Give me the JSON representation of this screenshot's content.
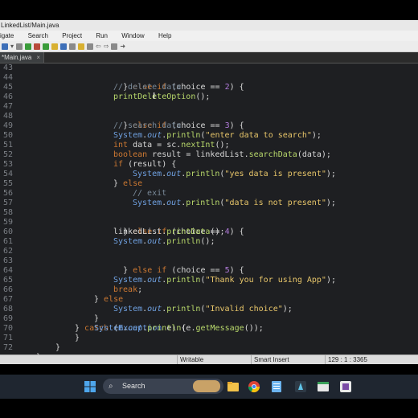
{
  "window": {
    "title": "LinkedList/Main.java"
  },
  "menu": [
    "igate",
    "Search",
    "Project",
    "Run",
    "Window",
    "Help"
  ],
  "tab": {
    "label": "*Main.java",
    "close": "×"
  },
  "editor": {
    "lines": [
      {
        "n": "43"
      },
      {
        "n": "44"
      },
      {
        "n": "45"
      },
      {
        "n": "46"
      },
      {
        "n": "47"
      },
      {
        "n": "48"
      },
      {
        "n": "49"
      },
      {
        "n": "50"
      },
      {
        "n": "51"
      },
      {
        "n": "52"
      },
      {
        "n": "53"
      },
      {
        "n": "54"
      },
      {
        "n": "55"
      },
      {
        "n": "56"
      },
      {
        "n": "57"
      },
      {
        "n": "58"
      },
      {
        "n": "59"
      },
      {
        "n": "60"
      },
      {
        "n": "61"
      },
      {
        "n": "62"
      },
      {
        "n": "63"
      },
      {
        "n": "64"
      },
      {
        "n": "65"
      },
      {
        "n": "66"
      },
      {
        "n": "67"
      },
      {
        "n": "68"
      },
      {
        "n": "69"
      },
      {
        "n": "70"
      },
      {
        "n": "71"
      },
      {
        "n": "72"
      }
    ],
    "code": {
      "l43": [
        "} ",
        "else if",
        " (choice == ",
        "2",
        ") {"
      ],
      "l44": "// delete data",
      "l45": [
        "printDeleteOption",
        "();"
      ],
      "l47": [
        "} ",
        "else if",
        " (choice == ",
        "3",
        ") {"
      ],
      "l48": "// search data",
      "l49": [
        "System",
        ".",
        "out",
        ".",
        "println",
        "(",
        "\"enter data to search\"",
        ");"
      ],
      "l50": [
        "int",
        " data = sc.",
        "nextInt",
        "();"
      ],
      "l51": [
        "boolean",
        " result = linkedList.",
        "searchData",
        "(data);"
      ],
      "l52": [
        "if",
        " (result) {"
      ],
      "l53": [
        "System",
        ".",
        "out",
        ".",
        "println",
        "(",
        "\"yes data is present\"",
        ");"
      ],
      "l54": [
        "} ",
        "else"
      ],
      "l55": "// exit",
      "l56": [
        "System",
        ".",
        "out",
        ".",
        "println",
        "(",
        "\"data is not present\"",
        ");"
      ],
      "l58": [
        "} ",
        "else if",
        " (choice == ",
        "4",
        ") {"
      ],
      "l59": [
        "linkedList.",
        "printData",
        "();"
      ],
      "l60": [
        "System",
        ".",
        "out",
        ".",
        "println",
        "();"
      ],
      "l62": [
        "} ",
        "else if",
        " (choice == ",
        "5",
        ") {"
      ],
      "l64": [
        "System",
        ".",
        "out",
        ".",
        "println",
        "(",
        "\"Thank you for using App\"",
        ");"
      ],
      "l65": [
        "break",
        ";"
      ],
      "l66": [
        "} ",
        "else"
      ],
      "l67": [
        "System",
        ".",
        "out",
        ".",
        "println",
        "(",
        "\"Invalid choice\"",
        ");"
      ],
      "l68": "}",
      "l69": [
        "} ",
        "catch",
        " (",
        "Exception",
        " e) {"
      ],
      "l70": [
        "System",
        ".",
        "out",
        ".",
        "println",
        "(e.",
        "getMessage",
        "());"
      ],
      "l71": "}",
      "l72": "}",
      "l73": "}"
    }
  },
  "status": {
    "writable": "Writable",
    "insert": "Smart Insert",
    "position": "129 : 1 : 3365"
  },
  "taskbar": {
    "search": "Search"
  },
  "colors": {
    "editor_bg": "#1e1f22",
    "keyword": "#cc7832",
    "string": "#e8c66a",
    "comment": "#7a8a99",
    "method": "#b8d86b"
  }
}
